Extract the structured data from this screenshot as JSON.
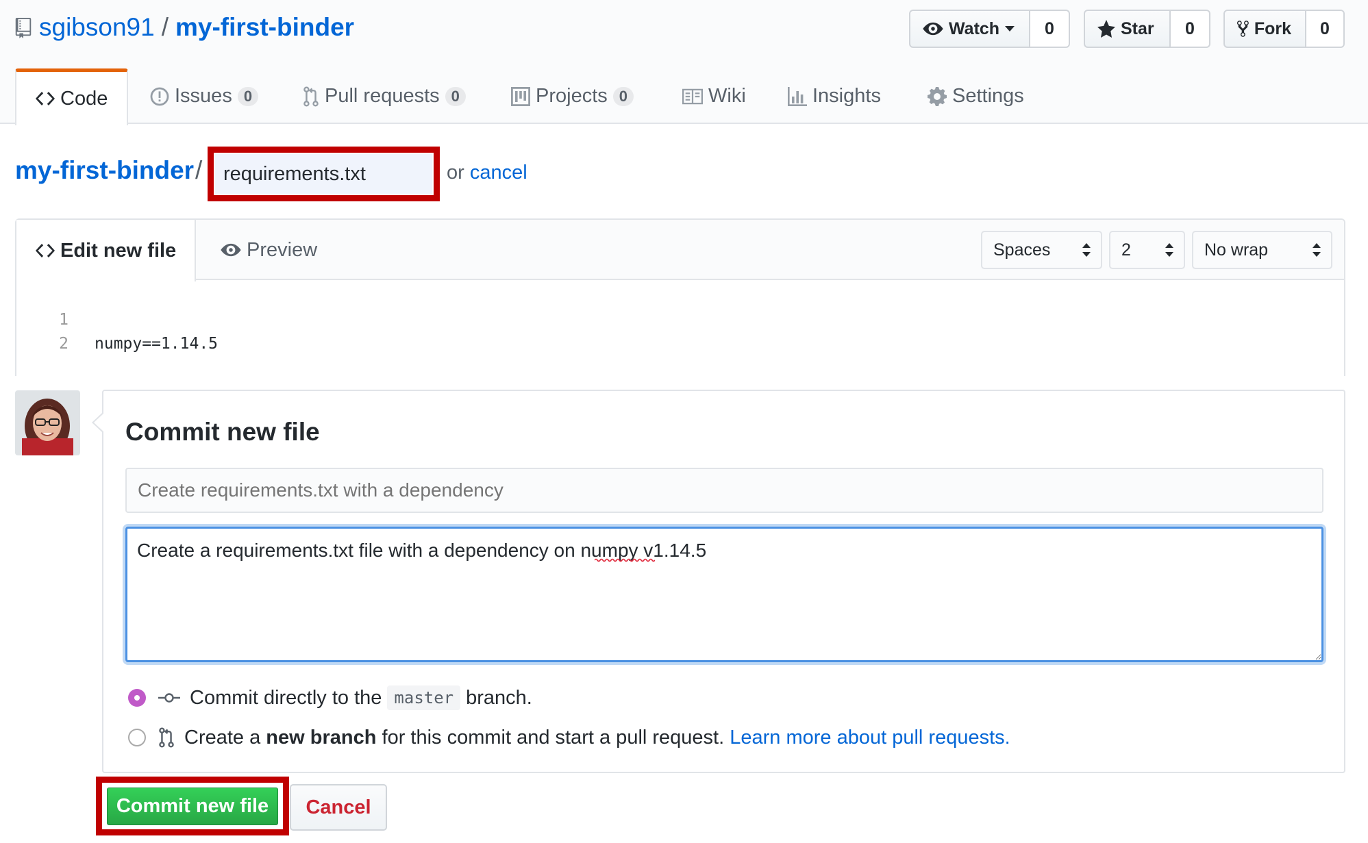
{
  "repo": {
    "owner": "sgibson91",
    "separator": "/",
    "name": "my-first-binder"
  },
  "actions": {
    "watch": {
      "label": "Watch",
      "count": "0"
    },
    "star": {
      "label": "Star",
      "count": "0"
    },
    "fork": {
      "label": "Fork",
      "count": "0"
    }
  },
  "tabs": [
    {
      "label": "Code"
    },
    {
      "label": "Issues",
      "count": "0"
    },
    {
      "label": "Pull requests",
      "count": "0"
    },
    {
      "label": "Projects",
      "count": "0"
    },
    {
      "label": "Wiki"
    },
    {
      "label": "Insights"
    },
    {
      "label": "Settings"
    }
  ],
  "breadcrumb": {
    "repo": "my-first-binder",
    "separator": "/",
    "filename": "requirements.txt",
    "or_text": "or",
    "cancel": "cancel"
  },
  "editor": {
    "edit_tab": "Edit new file",
    "preview_tab": "Preview",
    "indent_mode": "Spaces",
    "indent_size": "2",
    "wrap_mode": "No wrap",
    "lines": [
      {
        "number": "1",
        "text": "numpy==1.14.5"
      },
      {
        "number": "2",
        "text": ""
      }
    ]
  },
  "commit": {
    "title": "Commit new file",
    "summary_placeholder": "Create requirements.txt with a dependency",
    "description": "Create a requirements.txt file with a dependency on numpy v1.14.5",
    "option_direct": {
      "prefix": "Commit directly to the",
      "branch": "master",
      "suffix": "branch."
    },
    "option_new_branch": {
      "prefix": "Create a",
      "bold": "new branch",
      "suffix": "for this commit and start a pull request.",
      "link": "Learn more about pull requests."
    },
    "submit_label": "Commit new file",
    "cancel_label": "Cancel"
  },
  "colors": {
    "link": "#0366d6",
    "accent_tab": "#e36209",
    "commit_green": "#28a745",
    "highlight_red": "#c00000",
    "radio_selected": "#c05ac8",
    "cancel_red": "#cb2431"
  }
}
